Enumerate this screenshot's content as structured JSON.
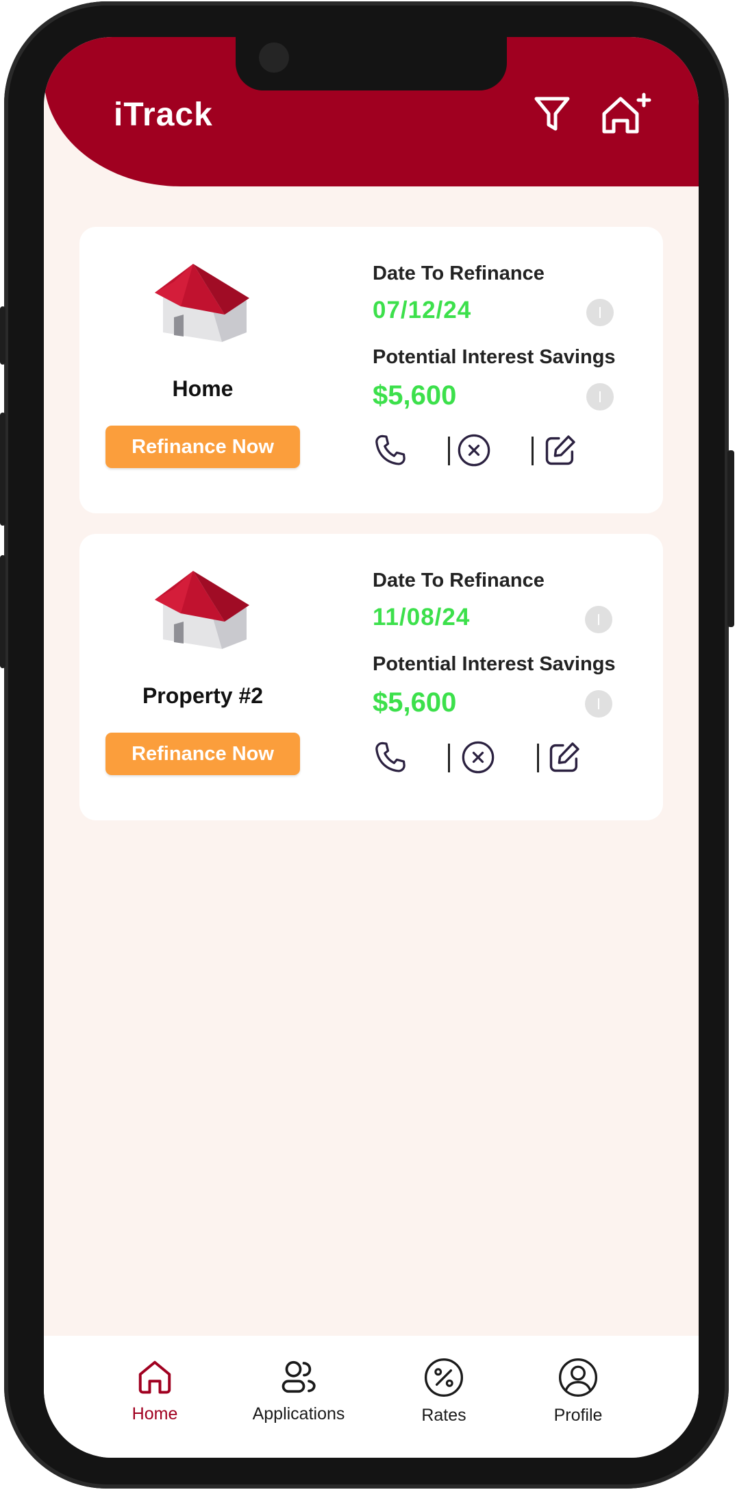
{
  "app": {
    "title": "iTrack"
  },
  "header": {
    "filter_icon": "filter-icon",
    "add_home_icon": "add-home-icon"
  },
  "properties": [
    {
      "name": "Home",
      "button_label": "Refinance Now",
      "date_label": "Date To Refinance",
      "date_value": "07/12/24",
      "savings_label": "Potential Interest Savings",
      "savings_value": "$5,600"
    },
    {
      "name": "Property #2",
      "button_label": "Refinance Now",
      "date_label": "Date To Refinance",
      "date_value": "11/08/24",
      "savings_label": "Potential Interest Savings",
      "savings_value": "$5,600"
    }
  ],
  "nav": {
    "items": [
      {
        "label": "Home",
        "icon": "home-icon",
        "active": true
      },
      {
        "label": "Applications",
        "icon": "users-icon",
        "active": false
      },
      {
        "label": "Rates",
        "icon": "percent-icon",
        "active": false
      },
      {
        "label": "Profile",
        "icon": "user-circle-icon",
        "active": false
      }
    ]
  },
  "colors": {
    "brand": "#a00020",
    "accent_orange": "#fb9e3c",
    "value_green": "#3ce04b",
    "background": "#fcf3ef"
  }
}
